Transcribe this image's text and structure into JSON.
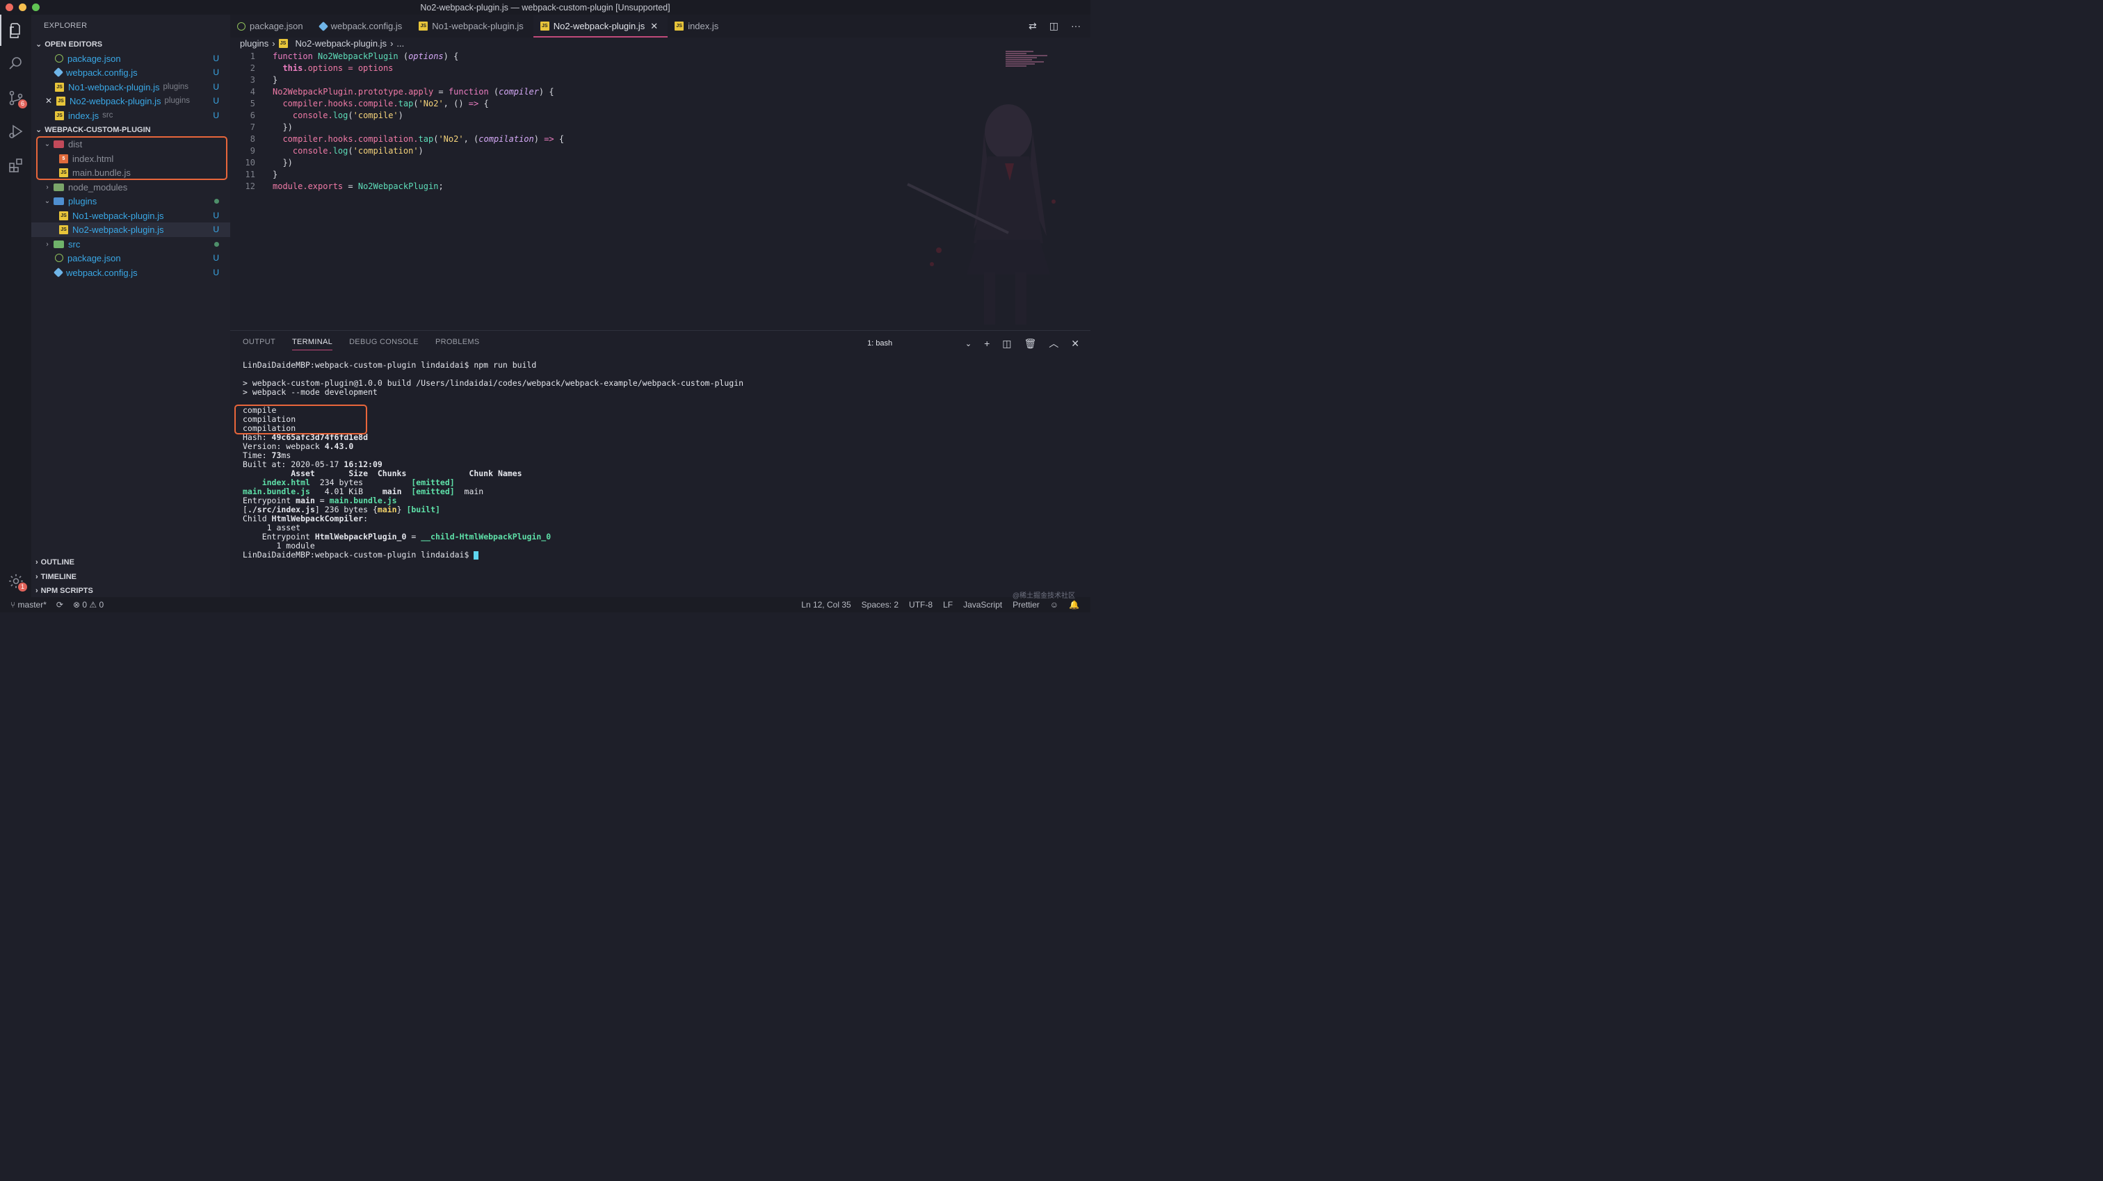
{
  "window": {
    "title": "No2-webpack-plugin.js — webpack-custom-plugin [Unsupported]"
  },
  "activity": {
    "scm_badge": "6",
    "settings_badge": "1"
  },
  "sidebar": {
    "title": "EXPLORER",
    "open_editors_label": "OPEN EDITORS",
    "open_editors": [
      {
        "label": "package.json",
        "hint": "",
        "status": "U"
      },
      {
        "label": "webpack.config.js",
        "hint": "",
        "status": "U"
      },
      {
        "label": "No1-webpack-plugin.js",
        "hint": "plugins",
        "status": "U"
      },
      {
        "label": "No2-webpack-plugin.js",
        "hint": "plugins",
        "status": "U"
      },
      {
        "label": "index.js",
        "hint": "src",
        "status": "U"
      }
    ],
    "project_label": "WEBPACK-CUSTOM-PLUGIN",
    "tree": {
      "dist": "dist",
      "index_html": "index.html",
      "main_bundle": "main.bundle.js",
      "node_modules": "node_modules",
      "plugins": "plugins",
      "no1": "No1-webpack-plugin.js",
      "no1_status": "U",
      "no2": "No2-webpack-plugin.js",
      "no2_status": "U",
      "src": "src",
      "package_json": "package.json",
      "package_status": "U",
      "webpack_config": "webpack.config.js",
      "webpack_status": "U"
    },
    "outline": "OUTLINE",
    "timeline": "TIMELINE",
    "npm_scripts": "NPM SCRIPTS"
  },
  "tabs": [
    "package.json",
    "webpack.config.js",
    "No1-webpack-plugin.js",
    "No2-webpack-plugin.js",
    "index.js"
  ],
  "breadcrumb": {
    "folder": "plugins",
    "file": "No2-webpack-plugin.js",
    "rest": "..."
  },
  "code": {
    "line_numbers": [
      "1",
      "2",
      "3",
      "4",
      "5",
      "6",
      "7",
      "8",
      "9",
      "10",
      "11",
      "12"
    ],
    "l1": {
      "kw": "function",
      "name": "No2WebpackPlugin",
      "open": " (",
      "param": "options",
      "close": ") {"
    },
    "l2": {
      "this": "this",
      "prop": ".options",
      "rest": " = options"
    },
    "l3": "}",
    "l4": {
      "name": "No2WebpackPlugin",
      "proto": ".prototype.apply",
      "eq": " = ",
      "kw": "function",
      "open": " (",
      "param": "compiler",
      "close": ") {"
    },
    "l5": {
      "a": "compiler.hooks.compile.",
      "tap": "tap",
      "open": "(",
      "str": "'No2'",
      "rest": ", () ",
      "arrow": "=>",
      "end": " {"
    },
    "l6": {
      "a": "console.",
      "fn": "log",
      "open": "(",
      "str": "'compile'",
      "close": ")"
    },
    "l7": "})",
    "l8": {
      "a": "compiler.hooks.compilation.",
      "tap": "tap",
      "open": "(",
      "str": "'No2'",
      "rest": ", (",
      "param": "compilation",
      "close": ") ",
      "arrow": "=>",
      "end": " {"
    },
    "l9": {
      "a": "console.",
      "fn": "log",
      "open": "(",
      "str": "'compilation'",
      "close": ")"
    },
    "l10": "})",
    "l11": "}",
    "l12": {
      "a": "module.exports",
      "eq": " = ",
      "name": "No2WebpackPlugin",
      "end": ";"
    }
  },
  "panel": {
    "tabs": [
      "OUTPUT",
      "TERMINAL",
      "DEBUG CONSOLE",
      "PROBLEMS"
    ],
    "terminal_select": "1: bash",
    "lines": {
      "cmd": "LinDaiDaideMBP:webpack-custom-plugin lindaidai$ npm run build",
      "build1": "> webpack-custom-plugin@1.0.0 build /Users/lindaidai/codes/webpack/webpack-example/webpack-custom-plugin",
      "build2": "> webpack --mode development",
      "compile": "compile",
      "compilation1": "compilation",
      "compilation2": "compilation",
      "hash_label": "Hash: ",
      "hash": "49c65afc3d74f6fd1e8d",
      "version_label": "Version: webpack ",
      "version": "4.43.0",
      "time_label": "Time: ",
      "time": "73",
      "time_unit": "ms",
      "built_label": "Built at: 2020-05-17 ",
      "built_time": "16:12:09",
      "header": "          Asset       Size  Chunks             Chunk Names",
      "r1_asset": "    index.html",
      "r1_size": "  234 bytes",
      "r1_gap": "          ",
      "r1_emit": "[emitted]",
      "r2_asset": "main.bundle.js",
      "r2_size": "   4.01 KiB",
      "r2_sp": "    ",
      "r2_chunk": "main",
      "r2_sp2": "  ",
      "r2_emit": "[emitted]",
      "r2_name": "  main",
      "entry_label": "Entrypoint ",
      "entry_name": "main",
      "entry_eq": " = ",
      "entry_file": "main.bundle.js",
      "src_open": "[",
      "src_path": "./src/index.js",
      "src_mid": "] 236 bytes {",
      "src_chunk": "main",
      "src_close": "} ",
      "src_built": "[built]",
      "child_label": "Child ",
      "child_name": "HtmlWebpackCompiler",
      "asset_count": "     1 asset",
      "entry2_label": "    Entrypoint ",
      "entry2_name": "HtmlWebpackPlugin_0",
      "entry2_eq": " = ",
      "entry2_file": "__child-HtmlWebpackPlugin_0",
      "module_count": "       1 module",
      "prompt": "LinDaiDaideMBP:webpack-custom-plugin lindaidai$ "
    }
  },
  "statusbar": {
    "branch": "master*",
    "errors": "0",
    "warnings": "0",
    "position": "Ln 12, Col 35",
    "spaces": "Spaces: 2",
    "encoding": "UTF-8",
    "eol": "LF",
    "language": "JavaScript",
    "formatter": "Prettier"
  },
  "watermark": "@稀土掘金技术社区",
  "colors": {
    "accent": "#c04a7a",
    "highlight_box": "#e8663b",
    "file_blue": "#3aa8e6"
  }
}
